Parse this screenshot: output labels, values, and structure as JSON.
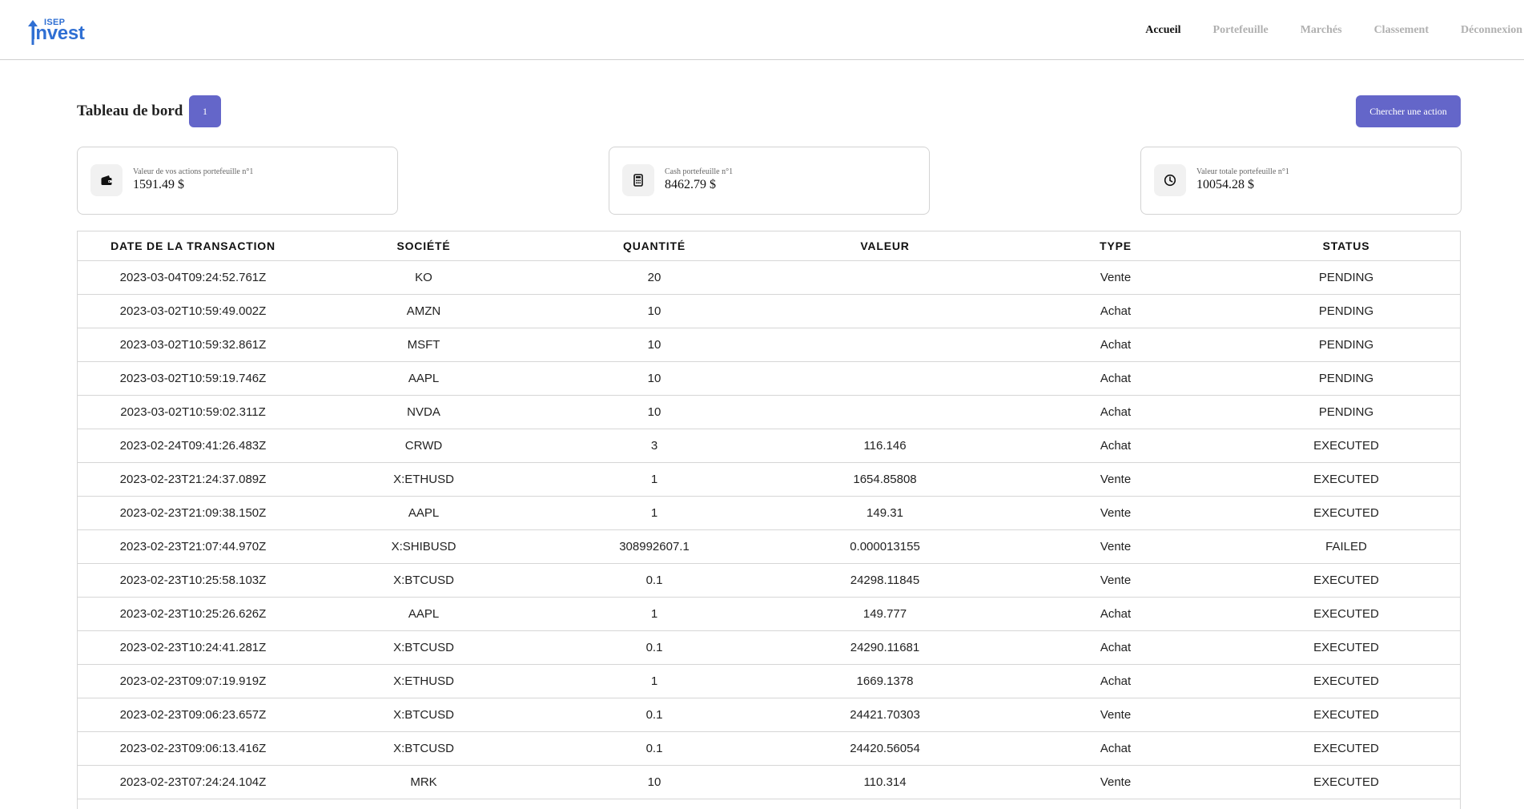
{
  "header": {
    "logo_small": "ISEP",
    "logo_main": "Invest",
    "nav": [
      "Accueil",
      "Portefeuille",
      "Marchés",
      "Classement",
      "Déconnexion"
    ],
    "active_nav": "Accueil"
  },
  "dashboard": {
    "title": "Tableau de bord",
    "portfolio_number": "1",
    "search_button": "Chercher une action"
  },
  "cards": [
    {
      "icon": "wallet-icon",
      "label": "Valeur de vos actions portefeuille n°1",
      "value": "1591.49 $"
    },
    {
      "icon": "calculator-icon",
      "label": "Cash portefeuille n°1",
      "value": "8462.79 $"
    },
    {
      "icon": "clock-icon",
      "label": "Valeur totale portefeuille n°1",
      "value": "10054.28 $"
    }
  ],
  "table": {
    "headers": [
      "DATE DE LA TRANSACTION",
      "SOCIÉTÉ",
      "QUANTITÉ",
      "VALEUR",
      "TYPE",
      "STATUS"
    ],
    "rows": [
      [
        "2023-03-04T09:24:52.761Z",
        "KO",
        "20",
        "",
        "Vente",
        "PENDING"
      ],
      [
        "2023-03-02T10:59:49.002Z",
        "AMZN",
        "10",
        "",
        "Achat",
        "PENDING"
      ],
      [
        "2023-03-02T10:59:32.861Z",
        "MSFT",
        "10",
        "",
        "Achat",
        "PENDING"
      ],
      [
        "2023-03-02T10:59:19.746Z",
        "AAPL",
        "10",
        "",
        "Achat",
        "PENDING"
      ],
      [
        "2023-03-02T10:59:02.311Z",
        "NVDA",
        "10",
        "",
        "Achat",
        "PENDING"
      ],
      [
        "2023-02-24T09:41:26.483Z",
        "CRWD",
        "3",
        "116.146",
        "Achat",
        "EXECUTED"
      ],
      [
        "2023-02-23T21:24:37.089Z",
        "X:ETHUSD",
        "1",
        "1654.85808",
        "Vente",
        "EXECUTED"
      ],
      [
        "2023-02-23T21:09:38.150Z",
        "AAPL",
        "1",
        "149.31",
        "Vente",
        "EXECUTED"
      ],
      [
        "2023-02-23T21:07:44.970Z",
        "X:SHIBUSD",
        "308992607.1",
        "0.000013155",
        "Vente",
        "FAILED"
      ],
      [
        "2023-02-23T10:25:58.103Z",
        "X:BTCUSD",
        "0.1",
        "24298.11845",
        "Vente",
        "EXECUTED"
      ],
      [
        "2023-02-23T10:25:26.626Z",
        "AAPL",
        "1",
        "149.777",
        "Achat",
        "EXECUTED"
      ],
      [
        "2023-02-23T10:24:41.281Z",
        "X:BTCUSD",
        "0.1",
        "24290.11681",
        "Achat",
        "EXECUTED"
      ],
      [
        "2023-02-23T09:07:19.919Z",
        "X:ETHUSD",
        "1",
        "1669.1378",
        "Achat",
        "EXECUTED"
      ],
      [
        "2023-02-23T09:06:23.657Z",
        "X:BTCUSD",
        "0.1",
        "24421.70303",
        "Vente",
        "EXECUTED"
      ],
      [
        "2023-02-23T09:06:13.416Z",
        "X:BTCUSD",
        "0.1",
        "24420.56054",
        "Achat",
        "EXECUTED"
      ],
      [
        "2023-02-23T07:24:24.104Z",
        "MRK",
        "10",
        "110.314",
        "Vente",
        "EXECUTED"
      ]
    ]
  },
  "colors": {
    "accent": "#6466c9",
    "brand": "#2f6fd3",
    "nav_inactive": "#b0b0b0"
  }
}
